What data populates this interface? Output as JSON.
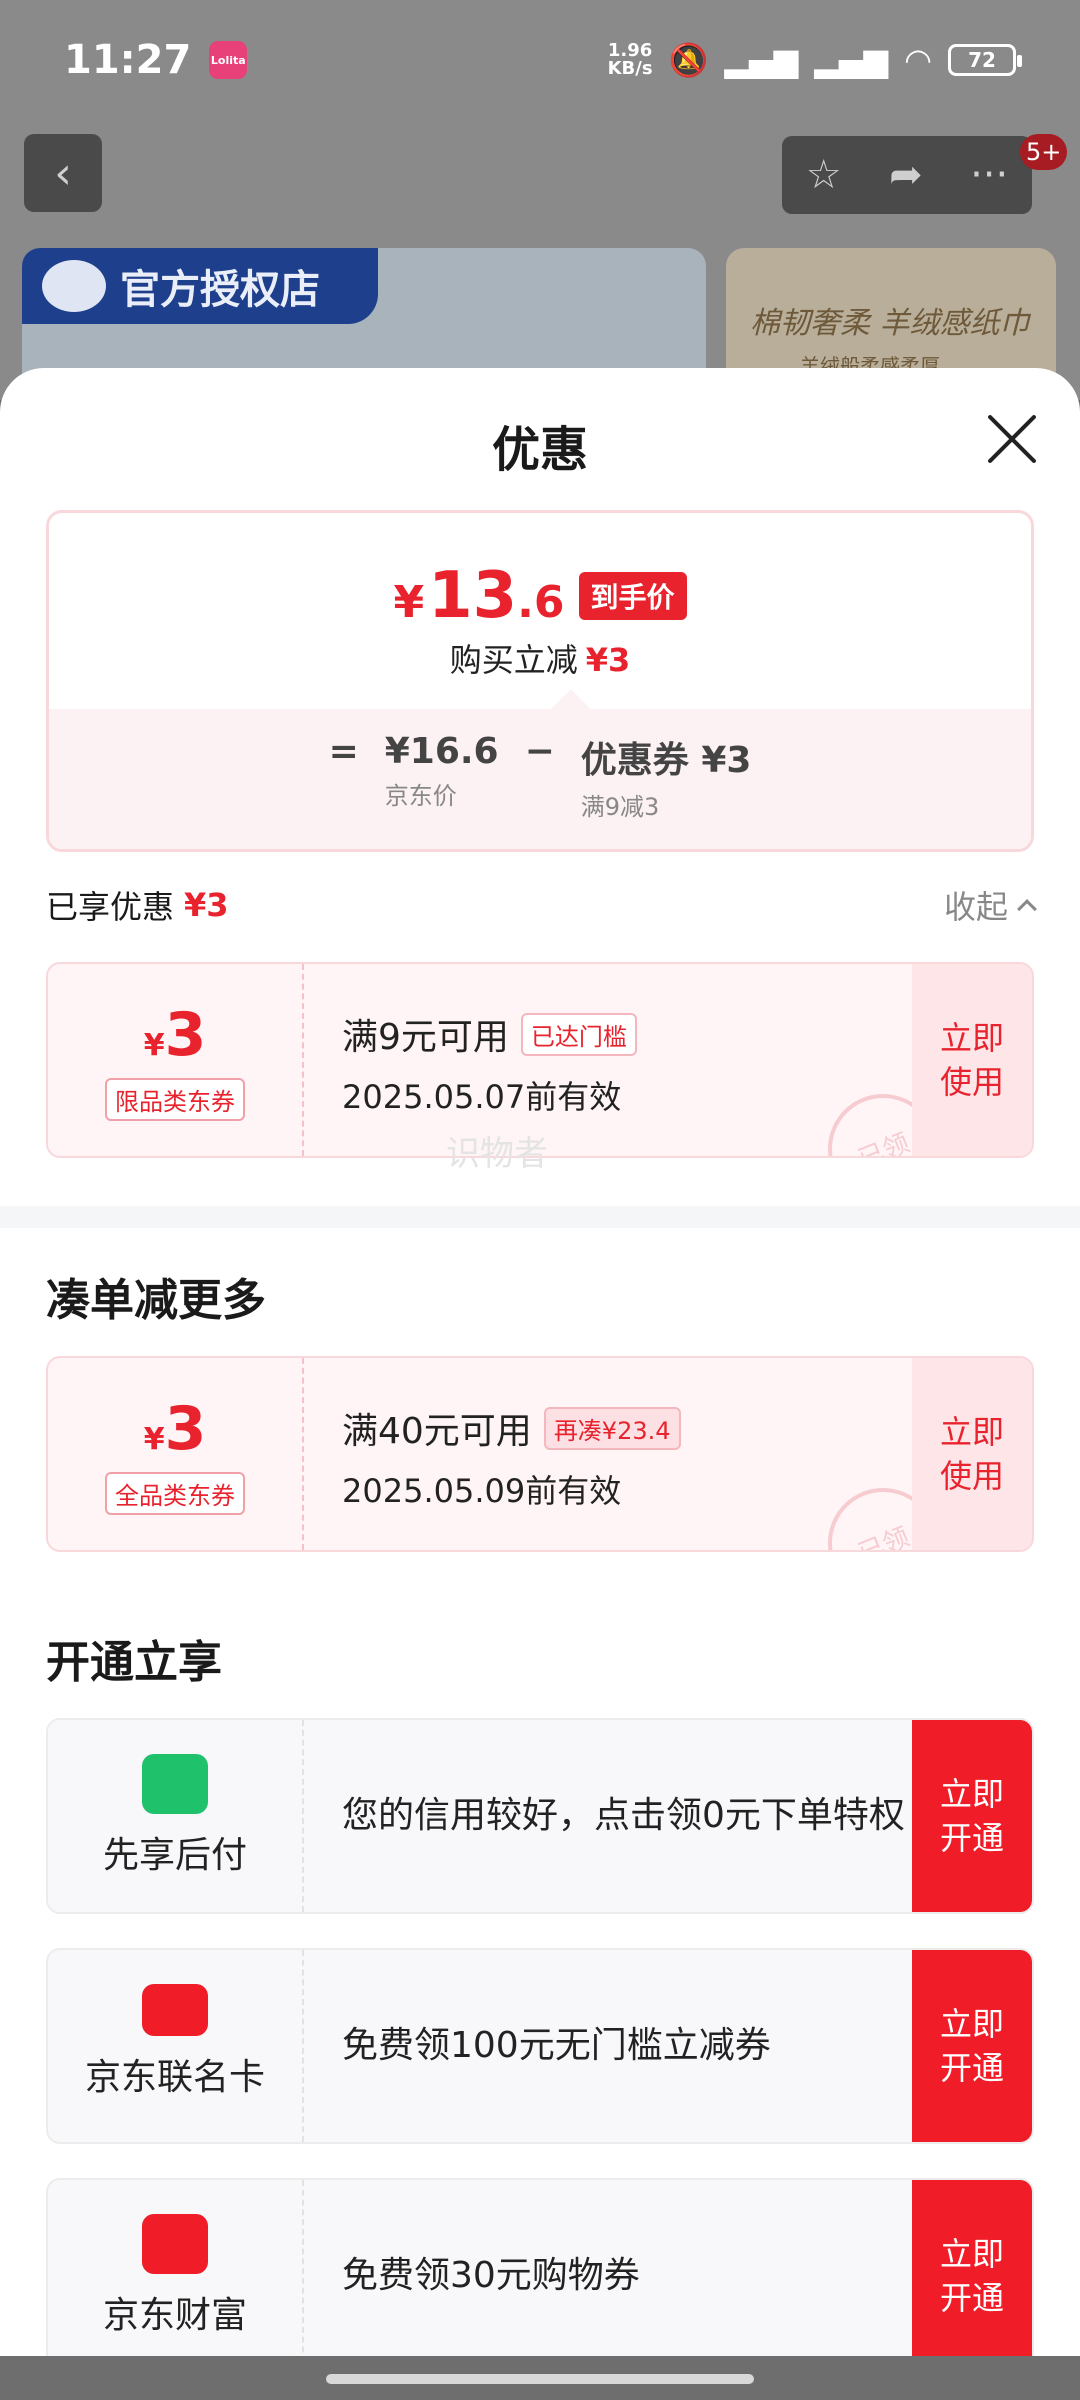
{
  "status_bar": {
    "time": "11:27",
    "app_icon": "Lolita",
    "speed_value": "1.96",
    "speed_unit": "KB/s",
    "battery": "72"
  },
  "top_nav": {
    "badge": "5+"
  },
  "banner": {
    "left_tag": "官方授权店",
    "right_title": "棉韧奢柔 羊绒感纸巾",
    "right_sub": "羊绒般柔感柔厚"
  },
  "sheet": {
    "title": "优惠",
    "price": {
      "symbol": "¥",
      "integer": "13",
      "decimal": ".6",
      "tag": "到手价",
      "discount_label": "购买立减",
      "discount_value": "¥3",
      "equals": "=",
      "minus": "−",
      "jd_price": "¥16.6",
      "jd_price_label": "京东价",
      "coupon_value": "优惠券 ¥3",
      "coupon_rule": "满9减3"
    },
    "enjoyed": {
      "label": "已享优惠",
      "value": "¥3",
      "collapse": "收起"
    },
    "coupons": [
      {
        "symbol": "¥",
        "amount": "3",
        "type": "限品类东券",
        "condition": "满9元可用",
        "flag": "已达门槛",
        "expiry": "2025.05.07前有效",
        "button": "立即使用",
        "stamp": "已领"
      },
      {
        "symbol": "¥",
        "amount": "3",
        "type": "全品类东券",
        "condition": "满40元可用",
        "flag": "再凑¥23.4",
        "expiry": "2025.05.09前有效",
        "button": "立即使用",
        "stamp": "已领"
      }
    ],
    "watermark": "识物者",
    "more_title": "凑单减更多",
    "open_title": "开通立享",
    "open_items": [
      {
        "icon": "shopping-bag-icon",
        "color": "#1fc16b",
        "name": "先享后付",
        "desc": "您的信用较好，点击领0元下单特权",
        "button": "立即开通"
      },
      {
        "icon": "credit-card-icon",
        "color": "#f01c27",
        "name": "京东联名卡",
        "desc": "免费领100元无门槛立减券",
        "button": "立即开通"
      },
      {
        "icon": "wallet-icon",
        "color": "#f01c27",
        "name": "京东财富",
        "desc": "免费领30元购物券",
        "button": "立即开通"
      }
    ]
  }
}
